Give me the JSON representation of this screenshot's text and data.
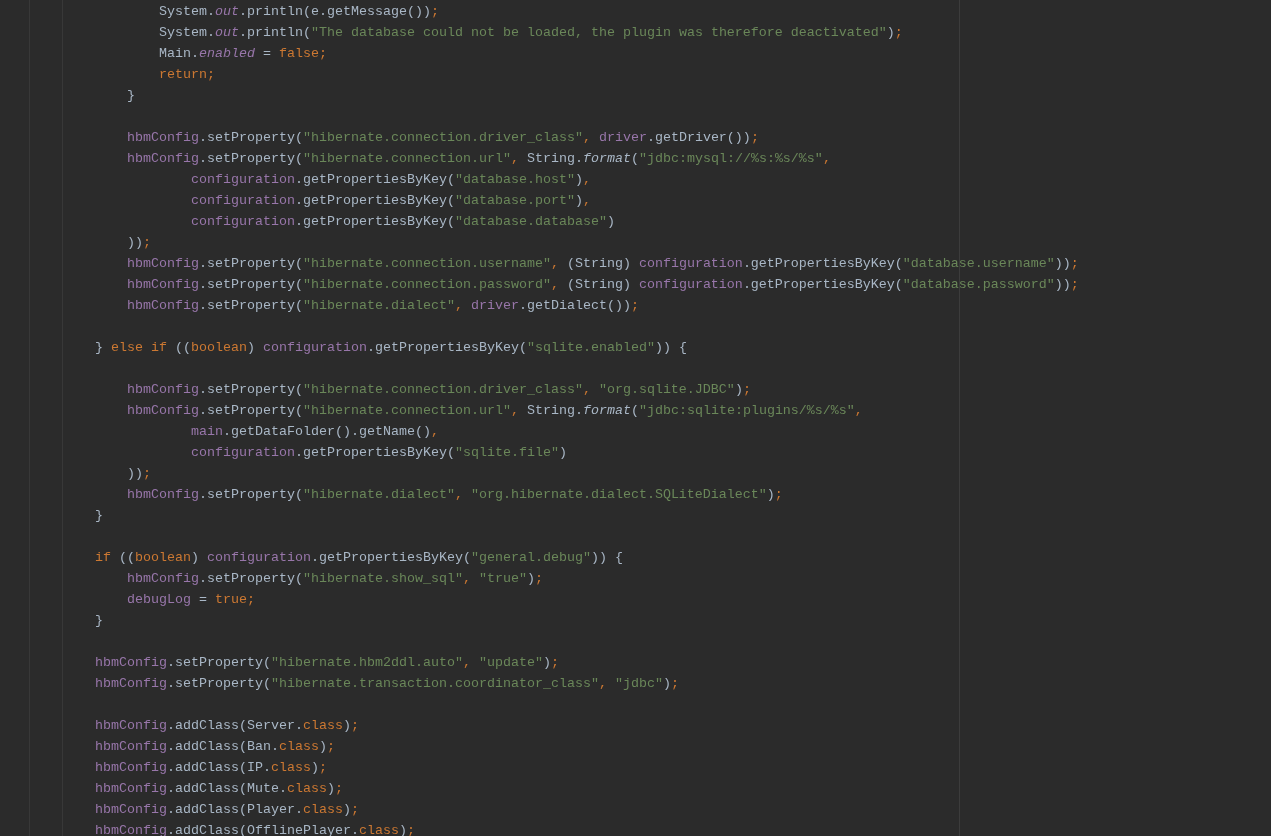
{
  "editor": {
    "blocks": [
      {
        "lines": [
          {
            "tokens": [
              {
                "kind": "plain",
                "text": "                System."
              },
              {
                "kind": "static_field",
                "text": "out"
              },
              {
                "kind": "plain",
                "text": ".println(e.getMessage())"
              },
              {
                "kind": "keyword",
                "text": ";"
              }
            ]
          },
          {
            "tokens": [
              {
                "kind": "plain",
                "text": "                System."
              },
              {
                "kind": "static_field",
                "text": "out"
              },
              {
                "kind": "plain",
                "text": ".println("
              },
              {
                "kind": "string",
                "text": "\"The database could not be loaded, the plugin was therefore deactivated\""
              },
              {
                "kind": "plain",
                "text": ")"
              },
              {
                "kind": "keyword",
                "text": ";"
              }
            ]
          },
          {
            "tokens": [
              {
                "kind": "plain",
                "text": "                Main."
              },
              {
                "kind": "static_field",
                "text": "enabled"
              },
              {
                "kind": "plain",
                "text": " = "
              },
              {
                "kind": "keyword",
                "text": "false;"
              }
            ]
          },
          {
            "tokens": [
              {
                "kind": "keyword",
                "text": "                return;"
              }
            ]
          },
          {
            "tokens": [
              {
                "kind": "plain",
                "text": "            }"
              }
            ]
          }
        ]
      },
      {
        "lines": [
          {
            "tokens": [
              {
                "kind": "field",
                "text": "            hbmConfig"
              },
              {
                "kind": "plain",
                "text": ".setProperty("
              },
              {
                "kind": "string",
                "text": "\"hibernate.connection.driver_class\""
              },
              {
                "kind": "keyword",
                "text": ", "
              },
              {
                "kind": "field",
                "text": "driver"
              },
              {
                "kind": "plain",
                "text": ".getDriver())"
              },
              {
                "kind": "keyword",
                "text": ";"
              }
            ]
          },
          {
            "tokens": [
              {
                "kind": "field",
                "text": "            hbmConfig"
              },
              {
                "kind": "plain",
                "text": ".setProperty("
              },
              {
                "kind": "string",
                "text": "\"hibernate.connection.url\""
              },
              {
                "kind": "keyword",
                "text": ", "
              },
              {
                "kind": "plain",
                "text": "String."
              },
              {
                "kind": "static_method",
                "text": "format"
              },
              {
                "kind": "plain",
                "text": "("
              },
              {
                "kind": "string",
                "text": "\"jdbc:mysql://%s:%s/%s\""
              },
              {
                "kind": "keyword",
                "text": ","
              }
            ]
          },
          {
            "tokens": [
              {
                "kind": "field",
                "text": "                    configuration"
              },
              {
                "kind": "plain",
                "text": ".getPropertiesByKey("
              },
              {
                "kind": "string",
                "text": "\"database.host\""
              },
              {
                "kind": "plain",
                "text": ")"
              },
              {
                "kind": "keyword",
                "text": ","
              }
            ]
          },
          {
            "tokens": [
              {
                "kind": "field",
                "text": "                    configuration"
              },
              {
                "kind": "plain",
                "text": ".getPropertiesByKey("
              },
              {
                "kind": "string",
                "text": "\"database.port\""
              },
              {
                "kind": "plain",
                "text": ")"
              },
              {
                "kind": "keyword",
                "text": ","
              }
            ]
          },
          {
            "tokens": [
              {
                "kind": "field",
                "text": "                    configuration"
              },
              {
                "kind": "plain",
                "text": ".getPropertiesByKey("
              },
              {
                "kind": "string",
                "text": "\"database.database\""
              },
              {
                "kind": "plain",
                "text": ")"
              }
            ]
          },
          {
            "tokens": [
              {
                "kind": "plain",
                "text": "            ))"
              },
              {
                "kind": "keyword",
                "text": ";"
              }
            ]
          },
          {
            "tokens": [
              {
                "kind": "field",
                "text": "            hbmConfig"
              },
              {
                "kind": "plain",
                "text": ".setProperty("
              },
              {
                "kind": "string",
                "text": "\"hibernate.connection.username\""
              },
              {
                "kind": "keyword",
                "text": ", "
              },
              {
                "kind": "plain",
                "text": "(String) "
              },
              {
                "kind": "field",
                "text": "configuration"
              },
              {
                "kind": "plain",
                "text": ".getPropertiesByKey("
              },
              {
                "kind": "string",
                "text": "\"database.username\""
              },
              {
                "kind": "plain",
                "text": "))"
              },
              {
                "kind": "keyword",
                "text": ";"
              }
            ]
          },
          {
            "tokens": [
              {
                "kind": "field",
                "text": "            hbmConfig"
              },
              {
                "kind": "plain",
                "text": ".setProperty("
              },
              {
                "kind": "string",
                "text": "\"hibernate.connection.password\""
              },
              {
                "kind": "keyword",
                "text": ", "
              },
              {
                "kind": "plain",
                "text": "(String) "
              },
              {
                "kind": "field",
                "text": "configuration"
              },
              {
                "kind": "plain",
                "text": ".getPropertiesByKey("
              },
              {
                "kind": "string",
                "text": "\"database.password\""
              },
              {
                "kind": "plain",
                "text": "))"
              },
              {
                "kind": "keyword",
                "text": ";"
              }
            ]
          },
          {
            "tokens": [
              {
                "kind": "field",
                "text": "            hbmConfig"
              },
              {
                "kind": "plain",
                "text": ".setProperty("
              },
              {
                "kind": "string",
                "text": "\"hibernate.dialect\""
              },
              {
                "kind": "keyword",
                "text": ", "
              },
              {
                "kind": "field",
                "text": "driver"
              },
              {
                "kind": "plain",
                "text": ".getDialect())"
              },
              {
                "kind": "keyword",
                "text": ";"
              }
            ]
          }
        ]
      },
      {
        "lines": [
          {
            "tokens": [
              {
                "kind": "plain",
                "text": "        } "
              },
              {
                "kind": "keyword",
                "text": "else if "
              },
              {
                "kind": "plain",
                "text": "(("
              },
              {
                "kind": "keyword",
                "text": "boolean"
              },
              {
                "kind": "plain",
                "text": ") "
              },
              {
                "kind": "field",
                "text": "configuration"
              },
              {
                "kind": "plain",
                "text": ".getPropertiesByKey("
              },
              {
                "kind": "string",
                "text": "\"sqlite.enabled\""
              },
              {
                "kind": "plain",
                "text": ")) {"
              }
            ]
          }
        ]
      },
      {
        "lines": [
          {
            "tokens": [
              {
                "kind": "field",
                "text": "            hbmConfig"
              },
              {
                "kind": "plain",
                "text": ".setProperty("
              },
              {
                "kind": "string",
                "text": "\"hibernate.connection.driver_class\""
              },
              {
                "kind": "keyword",
                "text": ", "
              },
              {
                "kind": "string",
                "text": "\"org.sqlite.JDBC\""
              },
              {
                "kind": "plain",
                "text": ")"
              },
              {
                "kind": "keyword",
                "text": ";"
              }
            ]
          },
          {
            "tokens": [
              {
                "kind": "field",
                "text": "            hbmConfig"
              },
              {
                "kind": "plain",
                "text": ".setProperty("
              },
              {
                "kind": "string",
                "text": "\"hibernate.connection.url\""
              },
              {
                "kind": "keyword",
                "text": ", "
              },
              {
                "kind": "plain",
                "text": "String."
              },
              {
                "kind": "static_method",
                "text": "format"
              },
              {
                "kind": "plain",
                "text": "("
              },
              {
                "kind": "string",
                "text": "\"jdbc:sqlite:plugins/%s/%s\""
              },
              {
                "kind": "keyword",
                "text": ","
              }
            ]
          },
          {
            "tokens": [
              {
                "kind": "field",
                "text": "                    main"
              },
              {
                "kind": "plain",
                "text": ".getDataFolder().getName()"
              },
              {
                "kind": "keyword",
                "text": ","
              }
            ]
          },
          {
            "tokens": [
              {
                "kind": "field",
                "text": "                    configuration"
              },
              {
                "kind": "plain",
                "text": ".getPropertiesByKey("
              },
              {
                "kind": "string",
                "text": "\"sqlite.file\""
              },
              {
                "kind": "plain",
                "text": ")"
              }
            ]
          },
          {
            "tokens": [
              {
                "kind": "plain",
                "text": "            ))"
              },
              {
                "kind": "keyword",
                "text": ";"
              }
            ]
          },
          {
            "tokens": [
              {
                "kind": "field",
                "text": "            hbmConfig"
              },
              {
                "kind": "plain",
                "text": ".setProperty("
              },
              {
                "kind": "string",
                "text": "\"hibernate.dialect\""
              },
              {
                "kind": "keyword",
                "text": ", "
              },
              {
                "kind": "string",
                "text": "\"org.hibernate.dialect.SQLiteDialect\""
              },
              {
                "kind": "plain",
                "text": ")"
              },
              {
                "kind": "keyword",
                "text": ";"
              }
            ]
          },
          {
            "tokens": [
              {
                "kind": "plain",
                "text": "        }"
              }
            ]
          }
        ]
      },
      {
        "lines": [
          {
            "tokens": [
              {
                "kind": "keyword",
                "text": "        if "
              },
              {
                "kind": "plain",
                "text": "(("
              },
              {
                "kind": "keyword",
                "text": "boolean"
              },
              {
                "kind": "plain",
                "text": ") "
              },
              {
                "kind": "field",
                "text": "configuration"
              },
              {
                "kind": "plain",
                "text": ".getPropertiesByKey("
              },
              {
                "kind": "string",
                "text": "\"general.debug\""
              },
              {
                "kind": "plain",
                "text": ")) {"
              }
            ]
          },
          {
            "tokens": [
              {
                "kind": "field",
                "text": "            hbmConfig"
              },
              {
                "kind": "plain",
                "text": ".setProperty("
              },
              {
                "kind": "string",
                "text": "\"hibernate.show_sql\""
              },
              {
                "kind": "keyword",
                "text": ", "
              },
              {
                "kind": "string",
                "text": "\"true\""
              },
              {
                "kind": "plain",
                "text": ")"
              },
              {
                "kind": "keyword",
                "text": ";"
              }
            ]
          },
          {
            "tokens": [
              {
                "kind": "field",
                "text": "            debugLog"
              },
              {
                "kind": "plain",
                "text": " = "
              },
              {
                "kind": "keyword",
                "text": "true;"
              }
            ]
          },
          {
            "tokens": [
              {
                "kind": "plain",
                "text": "        }"
              }
            ]
          }
        ]
      },
      {
        "lines": [
          {
            "tokens": [
              {
                "kind": "field",
                "text": "        hbmConfig"
              },
              {
                "kind": "plain",
                "text": ".setProperty("
              },
              {
                "kind": "string",
                "text": "\"hibernate.hbm2ddl.auto\""
              },
              {
                "kind": "keyword",
                "text": ", "
              },
              {
                "kind": "string",
                "text": "\"update\""
              },
              {
                "kind": "plain",
                "text": ")"
              },
              {
                "kind": "keyword",
                "text": ";"
              }
            ]
          },
          {
            "tokens": [
              {
                "kind": "field",
                "text": "        hbmConfig"
              },
              {
                "kind": "plain",
                "text": ".setProperty("
              },
              {
                "kind": "string",
                "text": "\"hibernate.transaction.coordinator_class\""
              },
              {
                "kind": "keyword",
                "text": ", "
              },
              {
                "kind": "string",
                "text": "\"jdbc\""
              },
              {
                "kind": "plain",
                "text": ")"
              },
              {
                "kind": "keyword",
                "text": ";"
              }
            ]
          }
        ]
      },
      {
        "lines": [
          {
            "tokens": [
              {
                "kind": "field",
                "text": "        hbmConfig"
              },
              {
                "kind": "plain",
                "text": ".addClass(Server."
              },
              {
                "kind": "keyword",
                "text": "class"
              },
              {
                "kind": "plain",
                "text": ")"
              },
              {
                "kind": "keyword",
                "text": ";"
              }
            ]
          },
          {
            "tokens": [
              {
                "kind": "field",
                "text": "        hbmConfig"
              },
              {
                "kind": "plain",
                "text": ".addClass(Ban."
              },
              {
                "kind": "keyword",
                "text": "class"
              },
              {
                "kind": "plain",
                "text": ")"
              },
              {
                "kind": "keyword",
                "text": ";"
              }
            ]
          },
          {
            "tokens": [
              {
                "kind": "field",
                "text": "        hbmConfig"
              },
              {
                "kind": "plain",
                "text": ".addClass(IP."
              },
              {
                "kind": "keyword",
                "text": "class"
              },
              {
                "kind": "plain",
                "text": ")"
              },
              {
                "kind": "keyword",
                "text": ";"
              }
            ]
          },
          {
            "tokens": [
              {
                "kind": "field",
                "text": "        hbmConfig"
              },
              {
                "kind": "plain",
                "text": ".addClass(Mute."
              },
              {
                "kind": "keyword",
                "text": "class"
              },
              {
                "kind": "plain",
                "text": ")"
              },
              {
                "kind": "keyword",
                "text": ";"
              }
            ]
          },
          {
            "tokens": [
              {
                "kind": "field",
                "text": "        hbmConfig"
              },
              {
                "kind": "plain",
                "text": ".addClass(Player."
              },
              {
                "kind": "keyword",
                "text": "class"
              },
              {
                "kind": "plain",
                "text": ")"
              },
              {
                "kind": "keyword",
                "text": ";"
              }
            ]
          },
          {
            "tokens": [
              {
                "kind": "field",
                "text": "        hbmConfig"
              },
              {
                "kind": "plain",
                "text": ".addClass(OfflinePlayer."
              },
              {
                "kind": "keyword",
                "text": "class"
              },
              {
                "kind": "plain",
                "text": ")"
              },
              {
                "kind": "keyword",
                "text": ";"
              }
            ]
          }
        ]
      }
    ]
  }
}
